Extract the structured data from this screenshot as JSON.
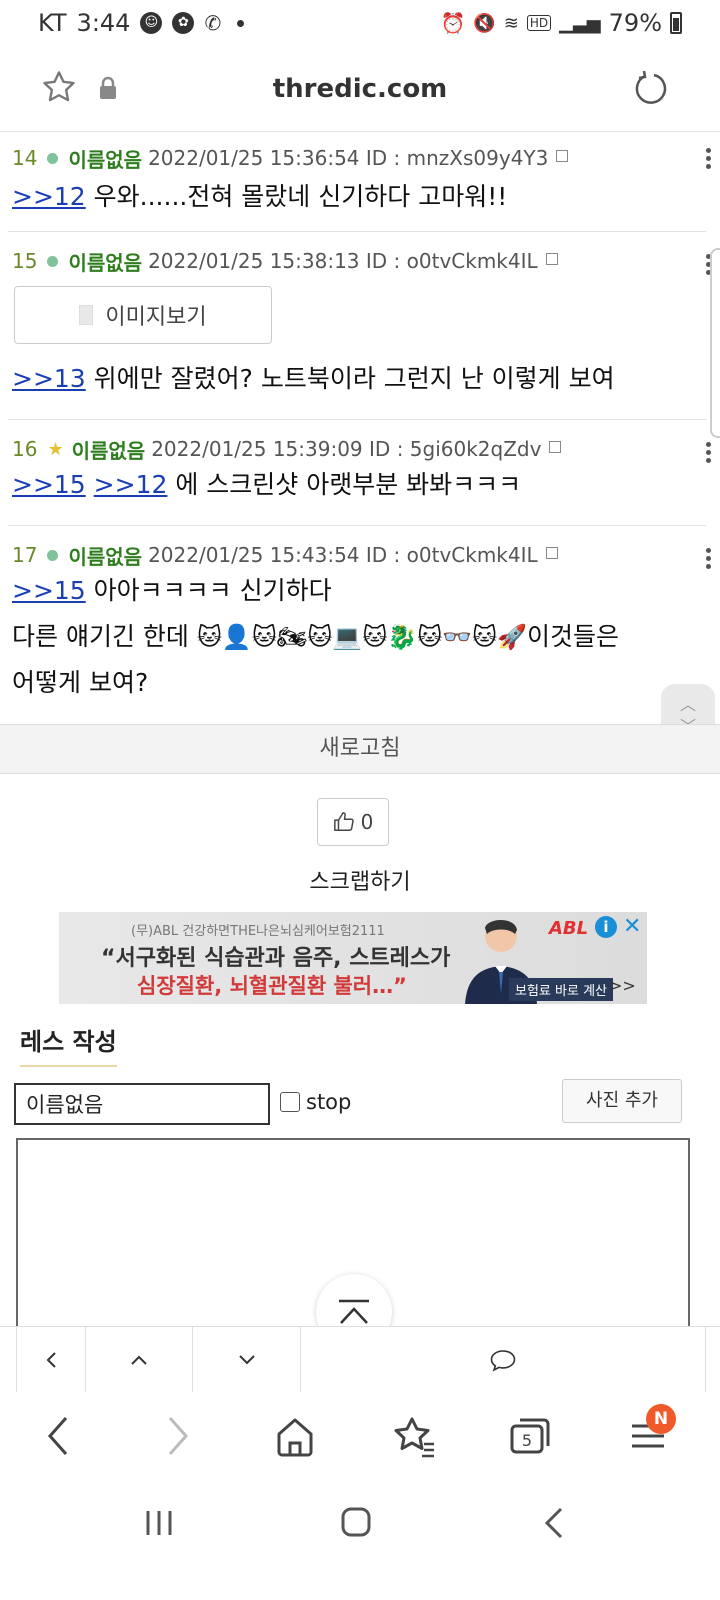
{
  "status_bar": {
    "carrier": "KT",
    "time": "3:44",
    "battery": "79%",
    "network": "HD"
  },
  "url_bar": {
    "domain": "thredic.com"
  },
  "posts": [
    {
      "num": "14",
      "marker": "dot",
      "name": "이름없음",
      "datetime": "2022/01/25 15:36:54",
      "id": "ID : mnzXs09y4Y3",
      "body": [
        {
          "anchors": [
            ">>12"
          ],
          "text": " 우와......전혀 몰랐네 신기하다 고마워!!"
        }
      ]
    },
    {
      "num": "15",
      "marker": "dot",
      "name": "이름없음",
      "datetime": "2022/01/25 15:38:13",
      "id": "ID : o0tvCkmk4IL",
      "image_button": "이미지보기",
      "body": [
        {
          "anchors": [
            ">>13"
          ],
          "text": " 위에만 잘렸어? 노트북이라 그런지 난 이렇게 보여"
        }
      ]
    },
    {
      "num": "16",
      "marker": "star",
      "name": "이름없음",
      "datetime": "2022/01/25 15:39:09",
      "id": "ID : 5gi60k2qZdv",
      "body": [
        {
          "anchors": [
            ">>15",
            ">>12"
          ],
          "text": " 에 스크린샷 아랫부분 봐봐ㅋㅋㅋ"
        }
      ]
    },
    {
      "num": "17",
      "marker": "dot",
      "name": "이름없음",
      "datetime": "2022/01/25 15:43:54",
      "id": "ID : o0tvCkmk4IL",
      "body": [
        {
          "anchors": [
            ">>15"
          ],
          "text": " 아아ㅋㅋㅋㅋ 신기하다"
        },
        {
          "anchors": [],
          "text": "다른 얘기긴 한데 "
        },
        {
          "anchors": [],
          "text": "이것들은"
        },
        {
          "anchors": [],
          "text": "어떻게 보여?"
        }
      ],
      "emojis": [
        "🐱",
        "👤",
        "🐱",
        "🏍",
        "🐱",
        "💻",
        "🐱",
        "🐉",
        "🐱",
        "👓",
        "🐱",
        "🚀"
      ]
    }
  ],
  "refresh_label": "새로고침",
  "like_count": "0",
  "scrap_label": "스크랩하기",
  "ad": {
    "small": "(무)ABL 건강하면THE나은뇌심케어보험2111",
    "line1": "“서구화된 식습관과 음주, 스트레스가",
    "line2": "심장질환, 뇌혈관질환 불러…”",
    "brand": "ABL",
    "cta": "보험료 바로 계산",
    "cta_arrow": ">>",
    "info": "i",
    "close": "✕"
  },
  "write_form": {
    "title": "레스 작성",
    "name_value": "이름없음",
    "stop_label": "stop",
    "photo_button": "사진 추가"
  },
  "browser_nav": {
    "tabs_count": "5",
    "menu_badge": "N"
  }
}
